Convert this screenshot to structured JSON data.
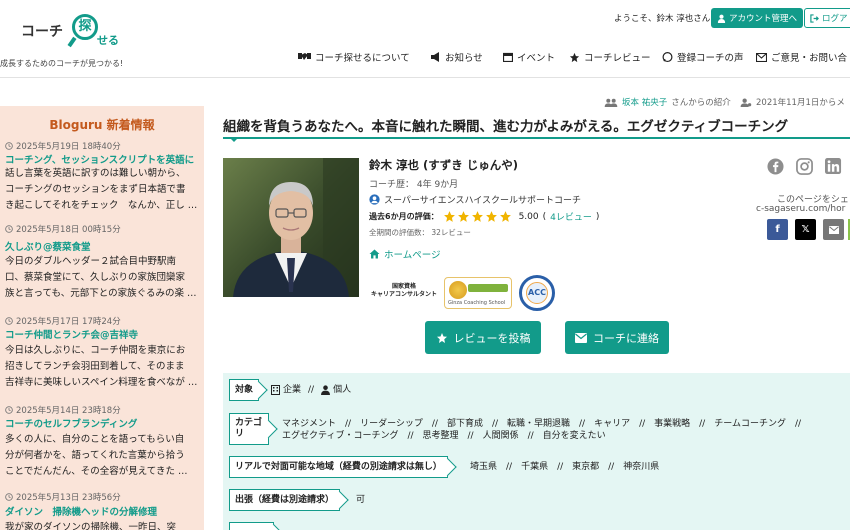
{
  "header": {
    "logo_text_left": "コーチ",
    "logo_text_right": "せる",
    "logo_char_circle": "探",
    "tagline": "成長するためのコーチが見つかる!",
    "welcome": "ようこそ、鈴木 淳也さん",
    "account_button": "アカウント管理へ",
    "logout_button": "ログア",
    "nav": [
      {
        "label": "コーチ探せるについて",
        "icon": "handshake-icon"
      },
      {
        "label": "お知らせ",
        "icon": "megaphone-icon"
      },
      {
        "label": "イベント",
        "icon": "calendar-icon"
      },
      {
        "label": "コーチレビュー",
        "icon": "star-icon"
      },
      {
        "label": "登録コーチの声",
        "icon": "comment-icon"
      },
      {
        "label": "ご意見・お問い合",
        "icon": "mail-icon"
      }
    ]
  },
  "sidebar": {
    "title": "Bloguru 新着情報",
    "posts": [
      {
        "date": "2025年5月19日 18時40分",
        "title": "コーチング、セッションスクリプトを英語に",
        "lines": [
          "話し言葉を英語に訳すのは難しい朝から、",
          "コーチングのセッションをまず日本語で書",
          "き起こしてそれをチェック　なんか、正し …"
        ]
      },
      {
        "date": "2025年5月18日 00時15分",
        "title": "久しぶり@蔡菜食堂",
        "lines": [
          "今日のダブルヘッダー２試合目中野駅南",
          "口、蔡菜食堂にて、久しぶりの家族団欒家",
          "族と言っても、元部下との家族ぐるみの楽 …"
        ]
      },
      {
        "date": "2025年5月17日 17時24分",
        "title": "コーチ仲間とランチ会@吉祥寺",
        "lines": [
          "今日は久しぶりに、コーチ仲間を東京にお",
          "招きしてランチ会羽田到着して、そのまま",
          "吉祥寺に美味しいスペイン料理を食べなが …"
        ]
      },
      {
        "date": "2025年5月14日 23時18分",
        "title": "コーチのセルフブランディング",
        "lines": [
          "多くの人に、自分のことを語ってもらい自",
          "分が何者かを、語ってくれた言葉から拾う",
          "ことでだんだん、その全容が見えてきた …"
        ]
      },
      {
        "date": "2025年5月13日 23時56分",
        "title": "ダイソン　掃除機ヘッドの分解修理",
        "lines": [
          "我が家のダイソンの掃除機、一昨日、突"
        ]
      }
    ]
  },
  "main": {
    "introducer_name": "坂本 祐央子",
    "introducer_suffix": "さんからの紹介",
    "date_text": "2021年11月1日からメ",
    "title": "組織を背負うあなたへ。本音に触れた瞬間、進む力がよみがえる。エグゼクティブコーチング",
    "coach_name": "鈴木 淳也 (すずき じゅんや)",
    "career": "コーチ歴：  4年 9か月",
    "school": "スーパーサイエンスハイスクールサポートコーチ",
    "rating_label": "過去6か月の評価：",
    "rating_value": "5.00",
    "rating_reviews": "4レビュー",
    "rating_stars": 5,
    "total_label": "全期間の評価数：  32レビュー",
    "homepage": "ホームページ",
    "badge_career_line1": "国家資格",
    "badge_career_line2": "キャリアコンサルタント",
    "badge_ginza": "Ginza Coaching School",
    "badge_acc": "ACC",
    "review_button": "レビューを投稿",
    "contact_button": "コーチに連絡",
    "share_text": "このページをシェ",
    "share_url": "c-sagaseru.com/hor",
    "info": {
      "target_label": "対象",
      "target_values": [
        "企業",
        "個人"
      ],
      "category_label": "カテゴリ",
      "category_line1": "マネジメント　//　リーダーシップ　//　部下育成　//　転職・早期退職　//　キャリア　//　事業戦略　//　チームコーチング　//",
      "category_line2": "エグゼクティブ・コーチング　//　思考整理　//　人間関係　//　自分を変えたい",
      "region_label": "リアルで対面可能な地域（経費の別途請求は無し）",
      "region_value": "埼玉県　//　千葉県　//　東京都　//　神奈川県",
      "travel_label": "出張（経費は別途請求）",
      "travel_value": "可"
    }
  }
}
